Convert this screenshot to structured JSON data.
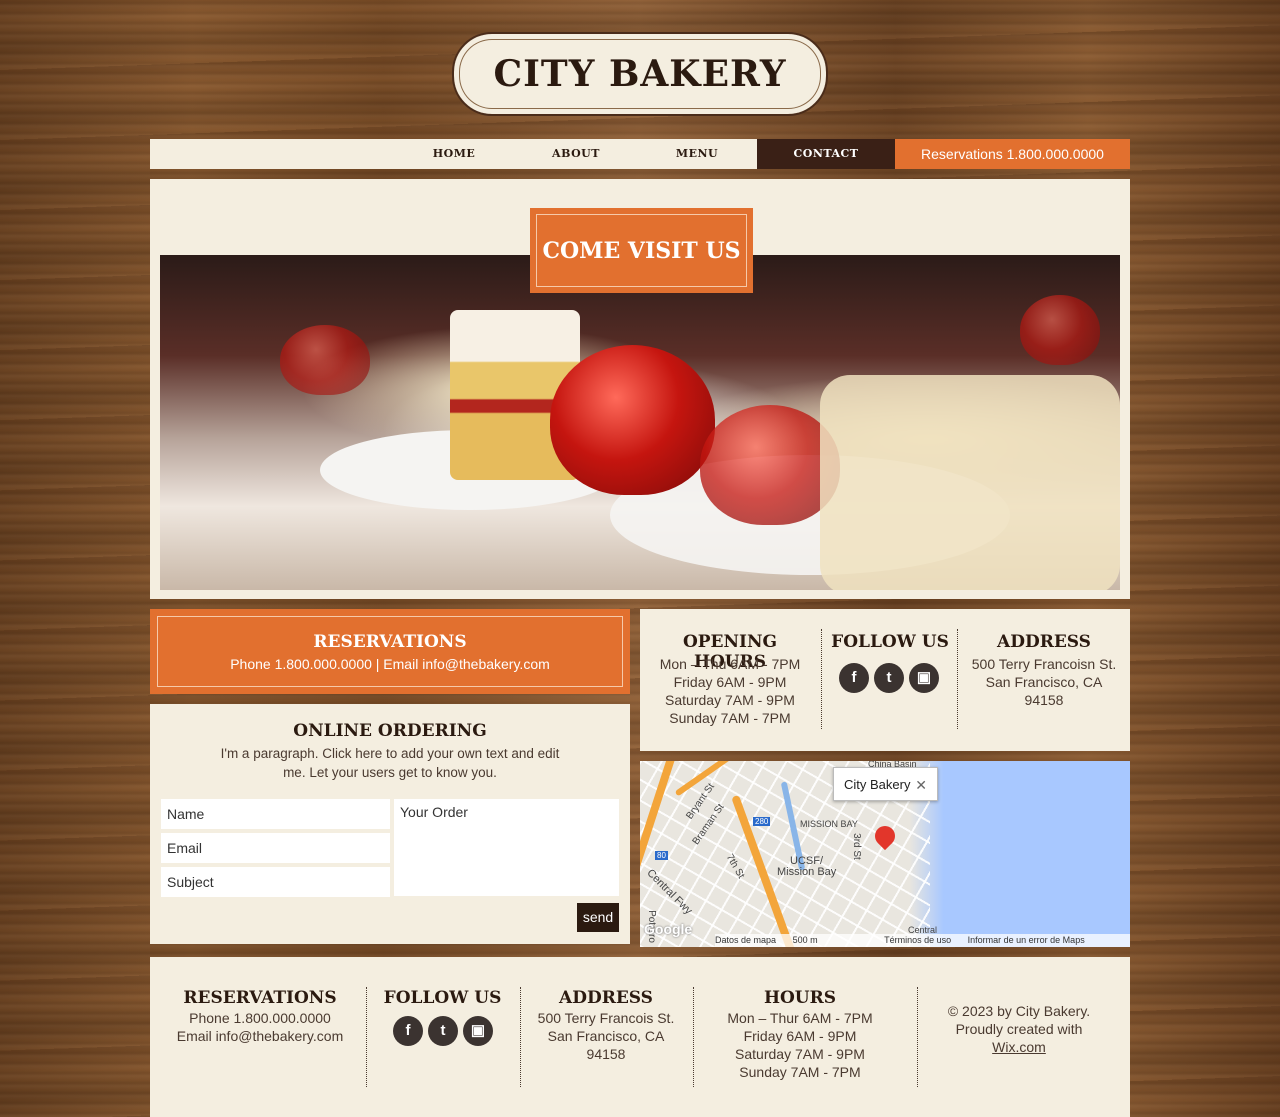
{
  "brand": {
    "name": "CITY BAKERY"
  },
  "nav": {
    "home": "HOME",
    "about": "ABOUT",
    "menu": "MENU",
    "contact": "CONTACT",
    "reservations": "Reservations 1.800.000.0000"
  },
  "hero": {
    "badge": "COME VISIT US"
  },
  "reservations_box": {
    "title": "RESERVATIONS",
    "line": "Phone 1.800.000.0000 | Email info@thebakery.com"
  },
  "online_ordering": {
    "title": "ONLINE ORDERING",
    "paragraph": "I'm a paragraph. Click here to add your own text and edit me. Let your users get to know you.",
    "fields": {
      "name": "Name",
      "email": "Email",
      "subject": "Subject",
      "order": "Your Order"
    },
    "send": "send"
  },
  "info": {
    "hours_title": "OPENING HOURS",
    "hours": [
      "Mon – Thu 6AM - 7PM",
      "Friday 6AM - 9PM",
      "Saturday  7AM - 9PM",
      "Sunday  7AM - 7PM"
    ],
    "follow_title": "FOLLOW US",
    "address_title": "ADDRESS",
    "address": [
      "500 Terry Francoisn St.",
      "San Francisco, CA",
      "94158"
    ]
  },
  "social": {
    "facebook": "f",
    "twitter": "t",
    "instagram": "▣"
  },
  "map": {
    "popup": "City Bakery",
    "close": "✕",
    "labels": {
      "bryant": "Bryant St",
      "brannan": "Braman St",
      "seventh": "7th St",
      "third": "3rd St",
      "mission_bay": "MISSION BAY",
      "ucsf": "UCSF/",
      "ucsf2": "Mission Bay",
      "central": "Central Fwy",
      "potrero": "Potrero",
      "china": "China Basin",
      "r280": "280",
      "r80": "80",
      "google": "Google",
      "central2": "Central"
    },
    "footer": [
      "Datos de mapa",
      "500 m",
      "Términos de uso",
      "Informar de un error de Maps"
    ]
  },
  "footer": {
    "res_title": "RESERVATIONS",
    "res_phone": "Phone 1.800.000.0000",
    "res_email": "Email info@thebakery.com",
    "follow_title": "FOLLOW US",
    "addr_title": "ADDRESS",
    "addr": [
      "500 Terry Francois St.",
      "San Francisco, CA",
      "94158"
    ],
    "hours_title": "HOURS",
    "hours": [
      "Mon – Thur  6AM - 7PM",
      "Friday  6AM - 9PM",
      "Saturday  7AM - 9PM",
      "Sunday  7AM - 7PM"
    ],
    "copyright": "© 2023 by City Bakery.",
    "created": "Proudly created with",
    "wix": "Wix.com"
  },
  "colors": {
    "accent": "#e2702f",
    "dark": "#2b1a10",
    "panel": "#f4eee0"
  }
}
